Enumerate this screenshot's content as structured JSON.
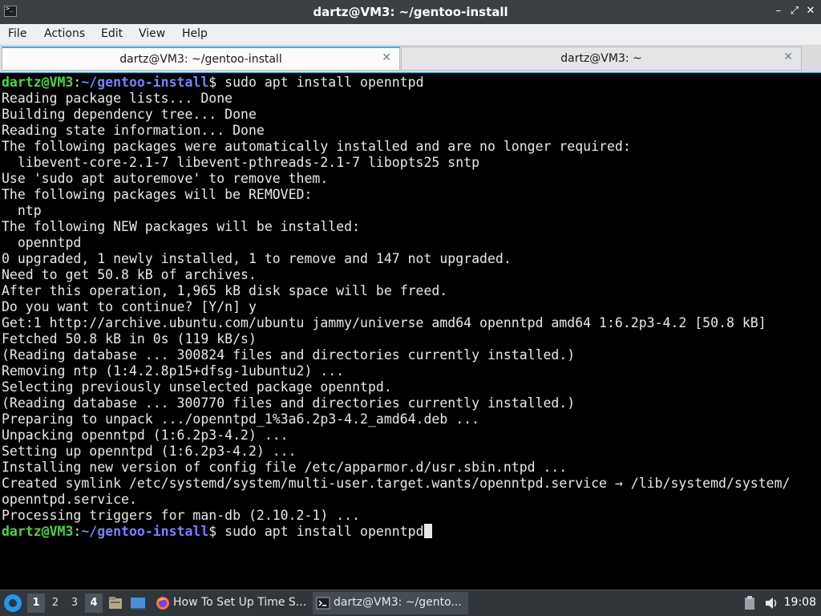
{
  "window": {
    "title": "dartz@VM3: ~/gentoo-install",
    "minimize_glyph": "–",
    "maximize_glyph": "⤢",
    "close_glyph": "✕"
  },
  "menu": [
    "File",
    "Actions",
    "Edit",
    "View",
    "Help"
  ],
  "tabs": [
    {
      "label": "dartz@VM3: ~/gentoo-install",
      "close": "✕"
    },
    {
      "label": "dartz@VM3: ~",
      "close": "✕"
    }
  ],
  "terminal": {
    "prompt_user": "dartz@VM3",
    "prompt_path": "~/gentoo-install",
    "first_command": "$ sudo apt install openntpd",
    "output": [
      "Reading package lists... Done",
      "Building dependency tree... Done",
      "Reading state information... Done",
      "The following packages were automatically installed and are no longer required:",
      "  libevent-core-2.1-7 libevent-pthreads-2.1-7 libopts25 sntp",
      "Use 'sudo apt autoremove' to remove them.",
      "The following packages will be REMOVED:",
      "  ntp",
      "The following NEW packages will be installed:",
      "  openntpd",
      "0 upgraded, 1 newly installed, 1 to remove and 147 not upgraded.",
      "Need to get 50.8 kB of archives.",
      "After this operation, 1,965 kB disk space will be freed.",
      "Do you want to continue? [Y/n] y",
      "Get:1 http://archive.ubuntu.com/ubuntu jammy/universe amd64 openntpd amd64 1:6.2p3-4.2 [50.8 kB]",
      "Fetched 50.8 kB in 0s (119 kB/s)",
      "(Reading database ... 300824 files and directories currently installed.)",
      "Removing ntp (1:4.2.8p15+dfsg-1ubuntu2) ...",
      "Selecting previously unselected package openntpd.",
      "(Reading database ... 300770 files and directories currently installed.)",
      "Preparing to unpack .../openntpd_1%3a6.2p3-4.2_amd64.deb ...",
      "Unpacking openntpd (1:6.2p3-4.2) ...",
      "Setting up openntpd (1:6.2p3-4.2) ...",
      "Installing new version of config file /etc/apparmor.d/usr.sbin.ntpd ...",
      "Created symlink /etc/systemd/system/multi-user.target.wants/openntpd.service → /lib/systemd/system/",
      "openntpd.service.",
      "Processing triggers for man-db (2.10.2-1) ..."
    ],
    "current_command": "$ sudo apt install openntpd"
  },
  "taskbar": {
    "workspaces": [
      "1",
      "2",
      "3",
      "4"
    ],
    "current_workspace": "4",
    "tasks": [
      {
        "label": "How To Set Up Time S...",
        "icon": "firefox-icon"
      },
      {
        "label": "dartz@VM3: ~/gento...",
        "icon": "terminal-icon"
      }
    ],
    "clock": "19:08"
  }
}
